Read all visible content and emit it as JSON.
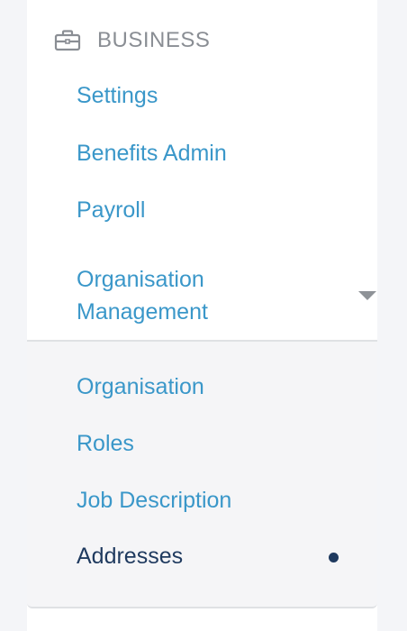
{
  "section": {
    "title": "BUSINESS",
    "icon": "briefcase-icon"
  },
  "nav": {
    "settings": "Settings",
    "benefits_admin": "Benefits Admin",
    "payroll": "Payroll"
  },
  "group": {
    "label": "Organisation Management",
    "expanded": true,
    "items": [
      {
        "label": "Organisation",
        "active": false
      },
      {
        "label": "Roles",
        "active": false
      },
      {
        "label": "Job Description",
        "active": false
      },
      {
        "label": "Addresses",
        "active": true
      }
    ]
  },
  "colors": {
    "link": "#3a97c9",
    "active": "#1f3a5f",
    "muted": "#8a8e94"
  }
}
